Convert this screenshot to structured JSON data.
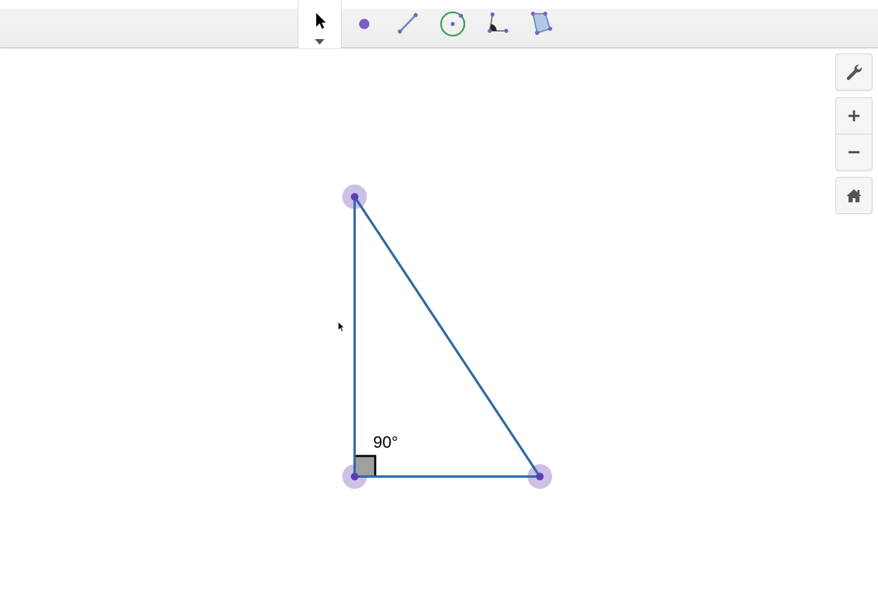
{
  "toolbar": {
    "tools": [
      {
        "id": "move",
        "icon": "move-arrow-icon",
        "selected": true
      },
      {
        "id": "point",
        "icon": "point-icon"
      },
      {
        "id": "segment",
        "icon": "segment-icon"
      },
      {
        "id": "circle",
        "icon": "circle-icon"
      },
      {
        "id": "angle",
        "icon": "angle-icon"
      },
      {
        "id": "polygon",
        "icon": "polygon-icon"
      }
    ],
    "menu_caret": "chevron-down-icon"
  },
  "side_buttons": {
    "settings": "wrench-icon",
    "zoom_in": "plus-icon",
    "zoom_out": "minus-icon",
    "home": "home-icon"
  },
  "construction": {
    "angle_label": "90°",
    "colors": {
      "segment": "#2f6aa3",
      "point": "#5b3fb5",
      "point_halo": "#c8b9e4",
      "right_angle_fill": "#a0a0a0"
    }
  }
}
